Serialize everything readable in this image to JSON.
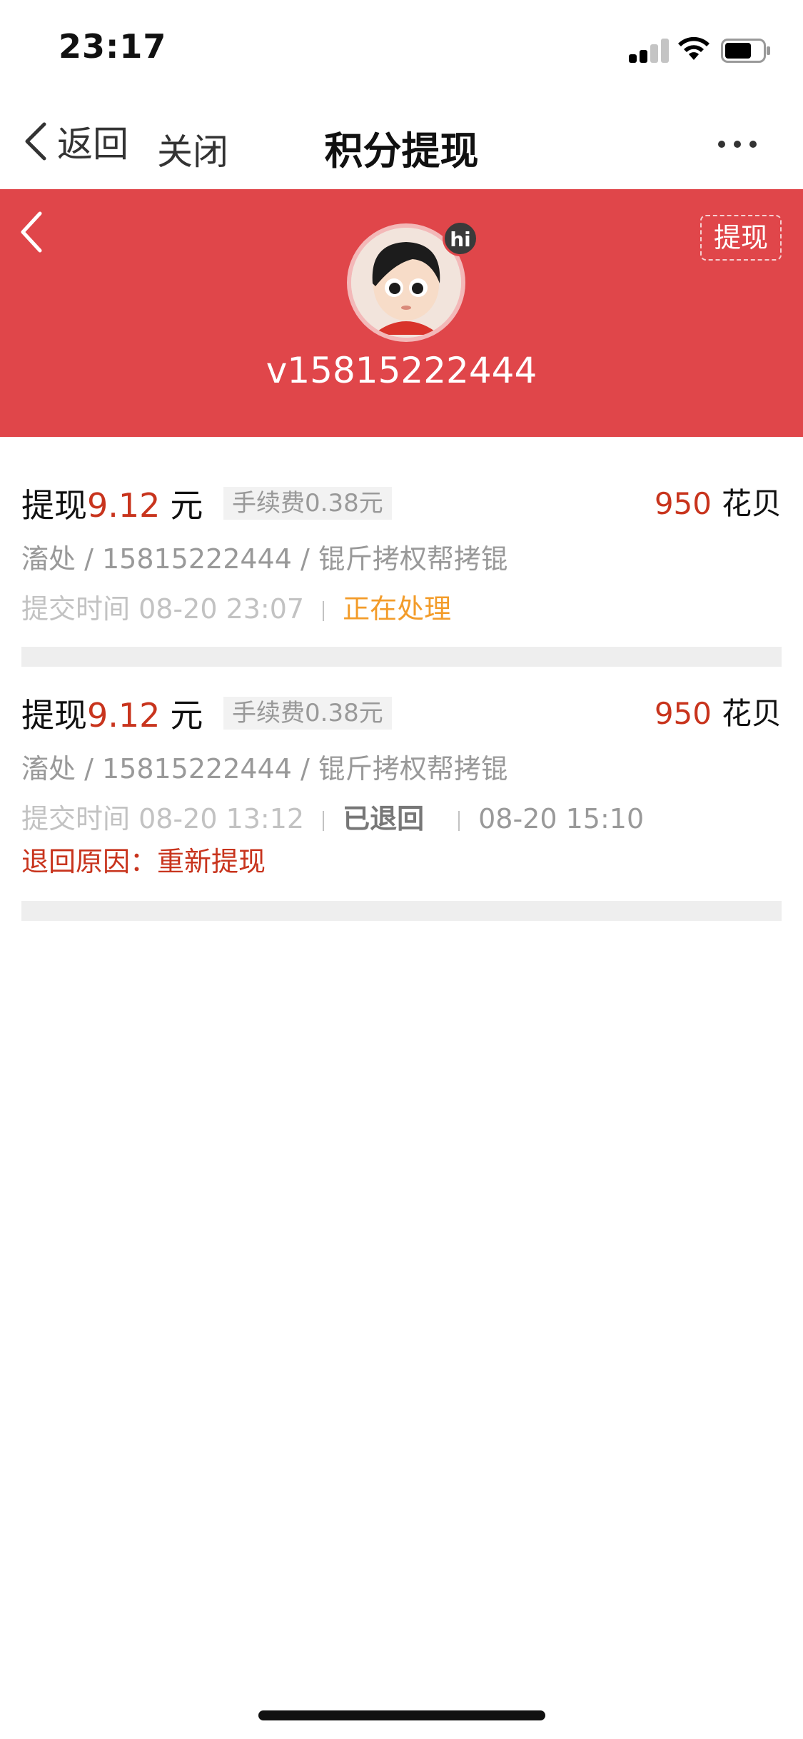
{
  "status_bar": {
    "time": "23:17"
  },
  "nav": {
    "back_label": "返回",
    "close_label": "关闭",
    "title": "积分提现"
  },
  "header": {
    "withdraw_label": "提现",
    "hi_badge": "hi",
    "username": "v15815222444"
  },
  "records": [
    {
      "title_prefix": "提现",
      "amount": "9.12",
      "unit": "元",
      "fee": "手续费0.38元",
      "points_value": "950",
      "points_unit": "花贝",
      "account": "滀处 / 15815222444 / 锟斤拷权帮拷锟",
      "submit_time": "提交时间 08-20 23:07",
      "status": "正在处理"
    },
    {
      "title_prefix": "提现",
      "amount": "9.12",
      "unit": "元",
      "fee": "手续费0.38元",
      "points_value": "950",
      "points_unit": "花贝",
      "account": "滀处 / 15815222444 / 锟斤拷权帮拷锟",
      "submit_time": "提交时间 08-20 13:12",
      "status": "已退回",
      "return_time": "08-20 15:10",
      "return_reason": "退回原因：重新提现"
    }
  ],
  "colors": {
    "header_red": "#e0464a",
    "amount_red": "#c8341d",
    "processing_orange": "#f39c2a"
  }
}
